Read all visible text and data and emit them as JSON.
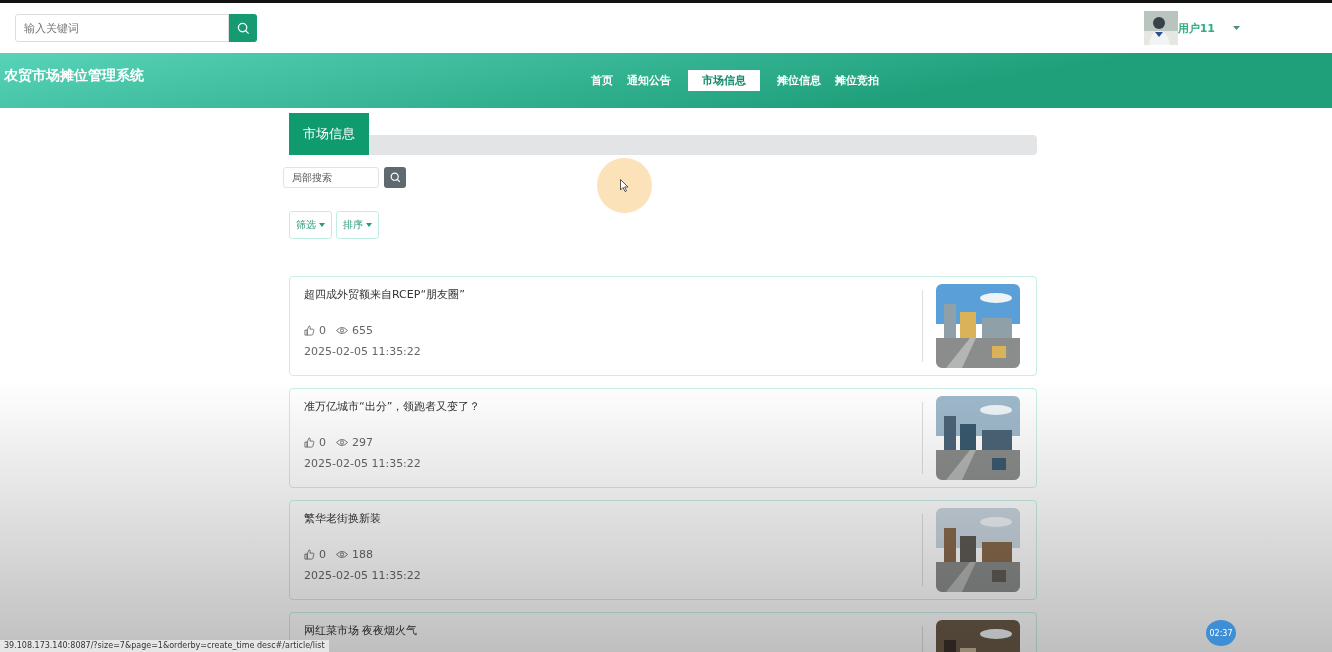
{
  "top_search": {
    "placeholder": "输入关键词"
  },
  "user": {
    "name": "用户11"
  },
  "header": {
    "title": "农贸市场摊位管理系统",
    "nav": [
      {
        "label": "首页",
        "selected": false
      },
      {
        "label": "通知公告",
        "selected": false
      },
      {
        "label": "市场信息",
        "selected": true
      },
      {
        "label": "摊位信息",
        "selected": false
      },
      {
        "label": "摊位竞拍",
        "selected": false
      }
    ]
  },
  "section": {
    "title": "市场信息",
    "search": {
      "placeholder": "局部搜索"
    },
    "filters": [
      "筛选",
      "排序"
    ]
  },
  "articles": [
    {
      "title": "超四成外贸额来自RCEP“朋友圈”",
      "likes": "0",
      "views": "655",
      "date": "2025-02-05 11:35:22"
    },
    {
      "title": "准万亿城市“出分”，领跑者又变了？",
      "likes": "0",
      "views": "297",
      "date": "2025-02-05 11:35:22"
    },
    {
      "title": "繁华老街换新装",
      "likes": "0",
      "views": "188",
      "date": "2025-02-05 11:35:22"
    },
    {
      "title": "网红菜市场 夜夜烟火气"
    }
  ],
  "status_bar": {
    "url": "39.108.173.140:8087/?size=7&page=1&orderby=create_time desc#/article/list"
  },
  "recording_badge": {
    "time": "02:37"
  }
}
